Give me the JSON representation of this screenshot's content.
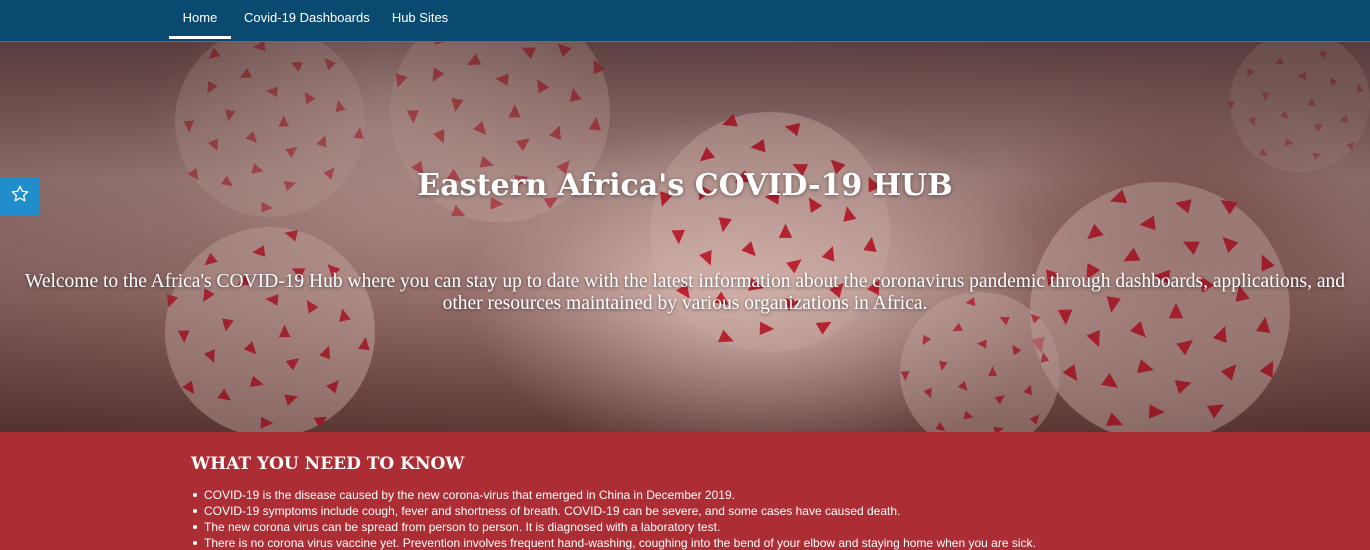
{
  "nav": {
    "tabs": [
      {
        "label": "Home",
        "active": true
      },
      {
        "label": "Covid-19 Dashboards",
        "active": false
      },
      {
        "label": "Hub Sites",
        "active": false
      }
    ]
  },
  "hero": {
    "title": "Eastern Africa's COVID-19 HUB",
    "subtitle": "Welcome to the Africa's COVID-19 Hub where you can stay up to date with the latest information about the coronavirus pandemic through dashboards, applications, and other resources maintained by various organizations in Africa."
  },
  "favorite_button": {
    "icon": "star-outline-icon"
  },
  "info": {
    "heading": "WHAT YOU NEED TO KNOW",
    "items": [
      "COVID-19 is the disease caused by the new corona-virus that emerged in China in December 2019.",
      "COVID-19 symptoms include cough, fever and shortness of breath. COVID-19 can be severe, and some cases have caused death.",
      "The new corona virus can be spread from person to person. It is diagnosed with a laboratory test.",
      "There is no corona virus vaccine yet. Prevention involves frequent hand-washing, coughing into the bend of your elbow and staying home when you are sick."
    ]
  },
  "colors": {
    "nav_background": "#0b4a70",
    "favorite_button": "#1f8ecb",
    "info_background": "#ad2d34",
    "virus_spike": "#c81e2e"
  }
}
